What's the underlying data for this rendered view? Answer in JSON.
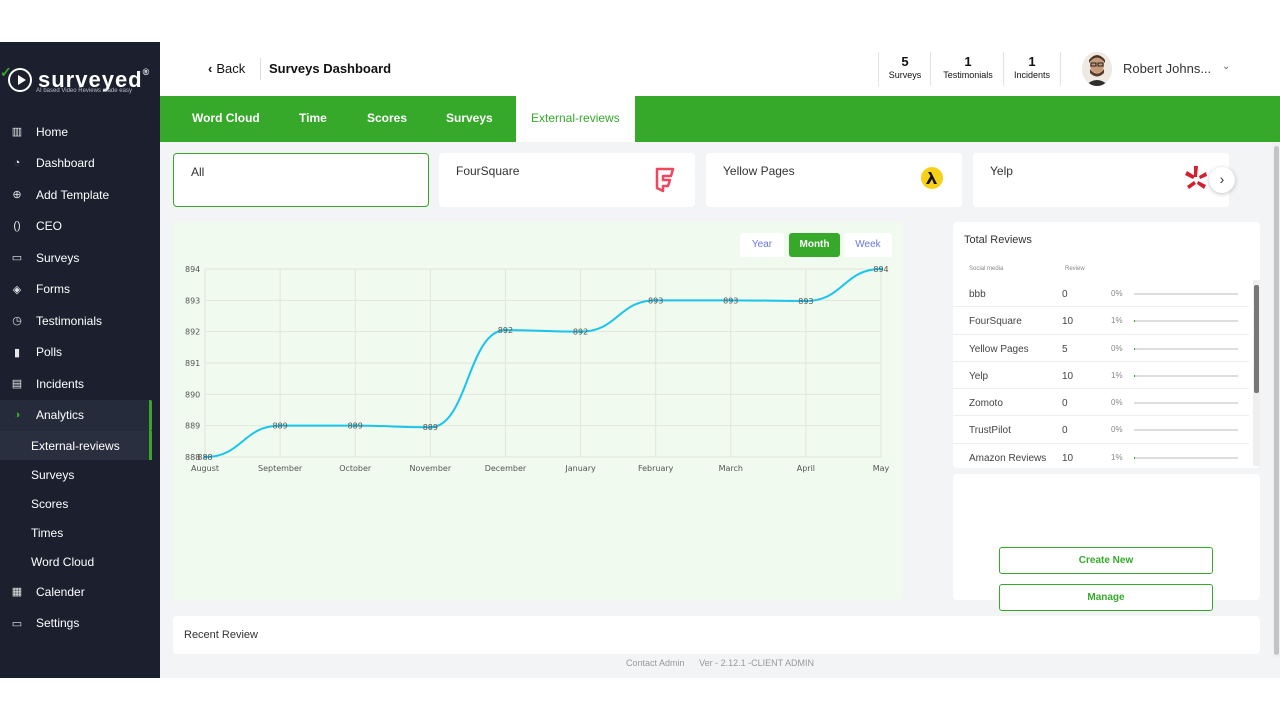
{
  "brand": {
    "name": "surveyed",
    "reg": "®",
    "tagline": "AI based Video Reviews made easy"
  },
  "sidebar": {
    "items": [
      {
        "label": "Home",
        "icon": "building-icon"
      },
      {
        "label": "Dashboard",
        "icon": "gauge-icon"
      },
      {
        "label": "Add Template",
        "icon": "plus-circle-icon"
      },
      {
        "label": "CEO",
        "icon": "brackets-icon"
      },
      {
        "label": "Surveys",
        "icon": "folder-icon"
      },
      {
        "label": "Forms",
        "icon": "shield-check-icon"
      },
      {
        "label": "Testimonials",
        "icon": "clock-icon"
      },
      {
        "label": "Polls",
        "icon": "bar-chart-icon"
      },
      {
        "label": "Incidents",
        "icon": "id-card-icon"
      },
      {
        "label": "Analytics",
        "icon": "pie-icon"
      }
    ],
    "sub_items": [
      "External-reviews",
      "Surveys",
      "Scores",
      "Times",
      "Word Cloud"
    ],
    "bottom_items": [
      {
        "label": "Calender",
        "icon": "calendar-icon"
      },
      {
        "label": "Settings",
        "icon": "folder-icon"
      }
    ]
  },
  "header": {
    "back_label": "Back",
    "title": "Surveys Dashboard",
    "stats": [
      {
        "value": "5",
        "label": "Surveys"
      },
      {
        "value": "1",
        "label": "Testimonials"
      },
      {
        "value": "1",
        "label": "Incidents"
      }
    ],
    "user_name": "Robert Johns..."
  },
  "tabs": [
    "Word Cloud",
    "Time",
    "Scores",
    "Surveys",
    "External-reviews"
  ],
  "sources": [
    "All",
    "FourSquare",
    "Yellow Pages",
    "Yelp"
  ],
  "ranges": [
    "Year",
    "Month",
    "Week"
  ],
  "chart_data": {
    "type": "line",
    "categories": [
      "August",
      "September",
      "October",
      "November",
      "December",
      "January",
      "February",
      "March",
      "April",
      "May"
    ],
    "values": [
      888,
      889,
      889,
      889,
      892,
      892,
      893,
      893,
      893,
      894
    ],
    "plotted": [
      888.0,
      889.0,
      889.0,
      888.95,
      892.05,
      892.0,
      893.0,
      893.0,
      892.98,
      894.0
    ],
    "point_labels": [
      "888",
      "889",
      "889",
      "889",
      "892",
      "892",
      "893",
      "893",
      "893",
      "894"
    ],
    "y_ticks": [
      "888",
      "889",
      "890",
      "891",
      "892",
      "893",
      "894"
    ],
    "ylim": [
      888,
      894
    ],
    "grid": true,
    "line_color": "#17c5ea",
    "title": "",
    "xlabel": "",
    "ylabel": ""
  },
  "totals": {
    "title": "Total Reviews",
    "col_media": "Social media",
    "col_review": "Review",
    "rows": [
      {
        "name": "bbb",
        "review": "0",
        "pct": "0%",
        "fill": 0
      },
      {
        "name": "FourSquare",
        "review": "10",
        "pct": "1%",
        "fill": 0.01
      },
      {
        "name": "Yellow Pages",
        "review": "5",
        "pct": "0%",
        "fill": 0.005
      },
      {
        "name": "Yelp",
        "review": "10",
        "pct": "1%",
        "fill": 0.01
      },
      {
        "name": "Zomoto",
        "review": "0",
        "pct": "0%",
        "fill": 0
      },
      {
        "name": "TrustPilot",
        "review": "0",
        "pct": "0%",
        "fill": 0
      },
      {
        "name": "Amazon Reviews",
        "review": "10",
        "pct": "1%",
        "fill": 0.01
      }
    ]
  },
  "actions": {
    "create": "Create New",
    "manage": "Manage"
  },
  "recent_title": "Recent Review",
  "footer": {
    "contact": "Contact Admin",
    "version": "Ver - 2.12.1 -CLIENT ADMIN"
  },
  "colors": {
    "accent": "#36a92b",
    "sidebar": "#1b1f2e",
    "chart_bg": "#f1faee"
  }
}
